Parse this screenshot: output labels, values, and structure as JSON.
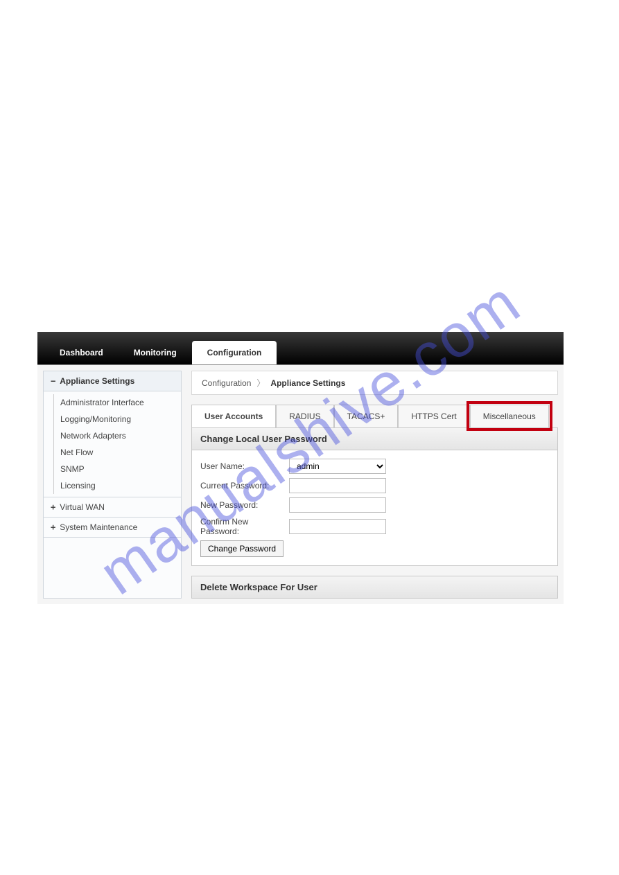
{
  "watermark": "manualshive.com",
  "topnav": {
    "items": [
      {
        "label": "Dashboard"
      },
      {
        "label": "Monitoring"
      },
      {
        "label": "Configuration",
        "active": true
      }
    ]
  },
  "sidebar": {
    "section_expanded_label": "Appliance Settings",
    "sub_items": [
      "Administrator Interface",
      "Logging/Monitoring",
      "Network Adapters",
      "Net Flow",
      "SNMP",
      "Licensing"
    ],
    "collapsed": [
      "Virtual WAN",
      "System Maintenance"
    ]
  },
  "breadcrumb": {
    "root": "Configuration",
    "current": "Appliance Settings"
  },
  "tabs": [
    {
      "label": "User Accounts",
      "active": true
    },
    {
      "label": "RADIUS"
    },
    {
      "label": "TACACS+"
    },
    {
      "label": "HTTPS Cert"
    },
    {
      "label": "Miscellaneous",
      "highlighted": true
    }
  ],
  "form": {
    "section_title": "Change Local User Password",
    "username_label": "User Name:",
    "username_value": "admin",
    "current_pw_label": "Current Password:",
    "new_pw_label": "New Password:",
    "confirm_pw_label": "Confirm New Password:",
    "button_label": "Change Password"
  },
  "secondary_section_title": "Delete Workspace For User"
}
